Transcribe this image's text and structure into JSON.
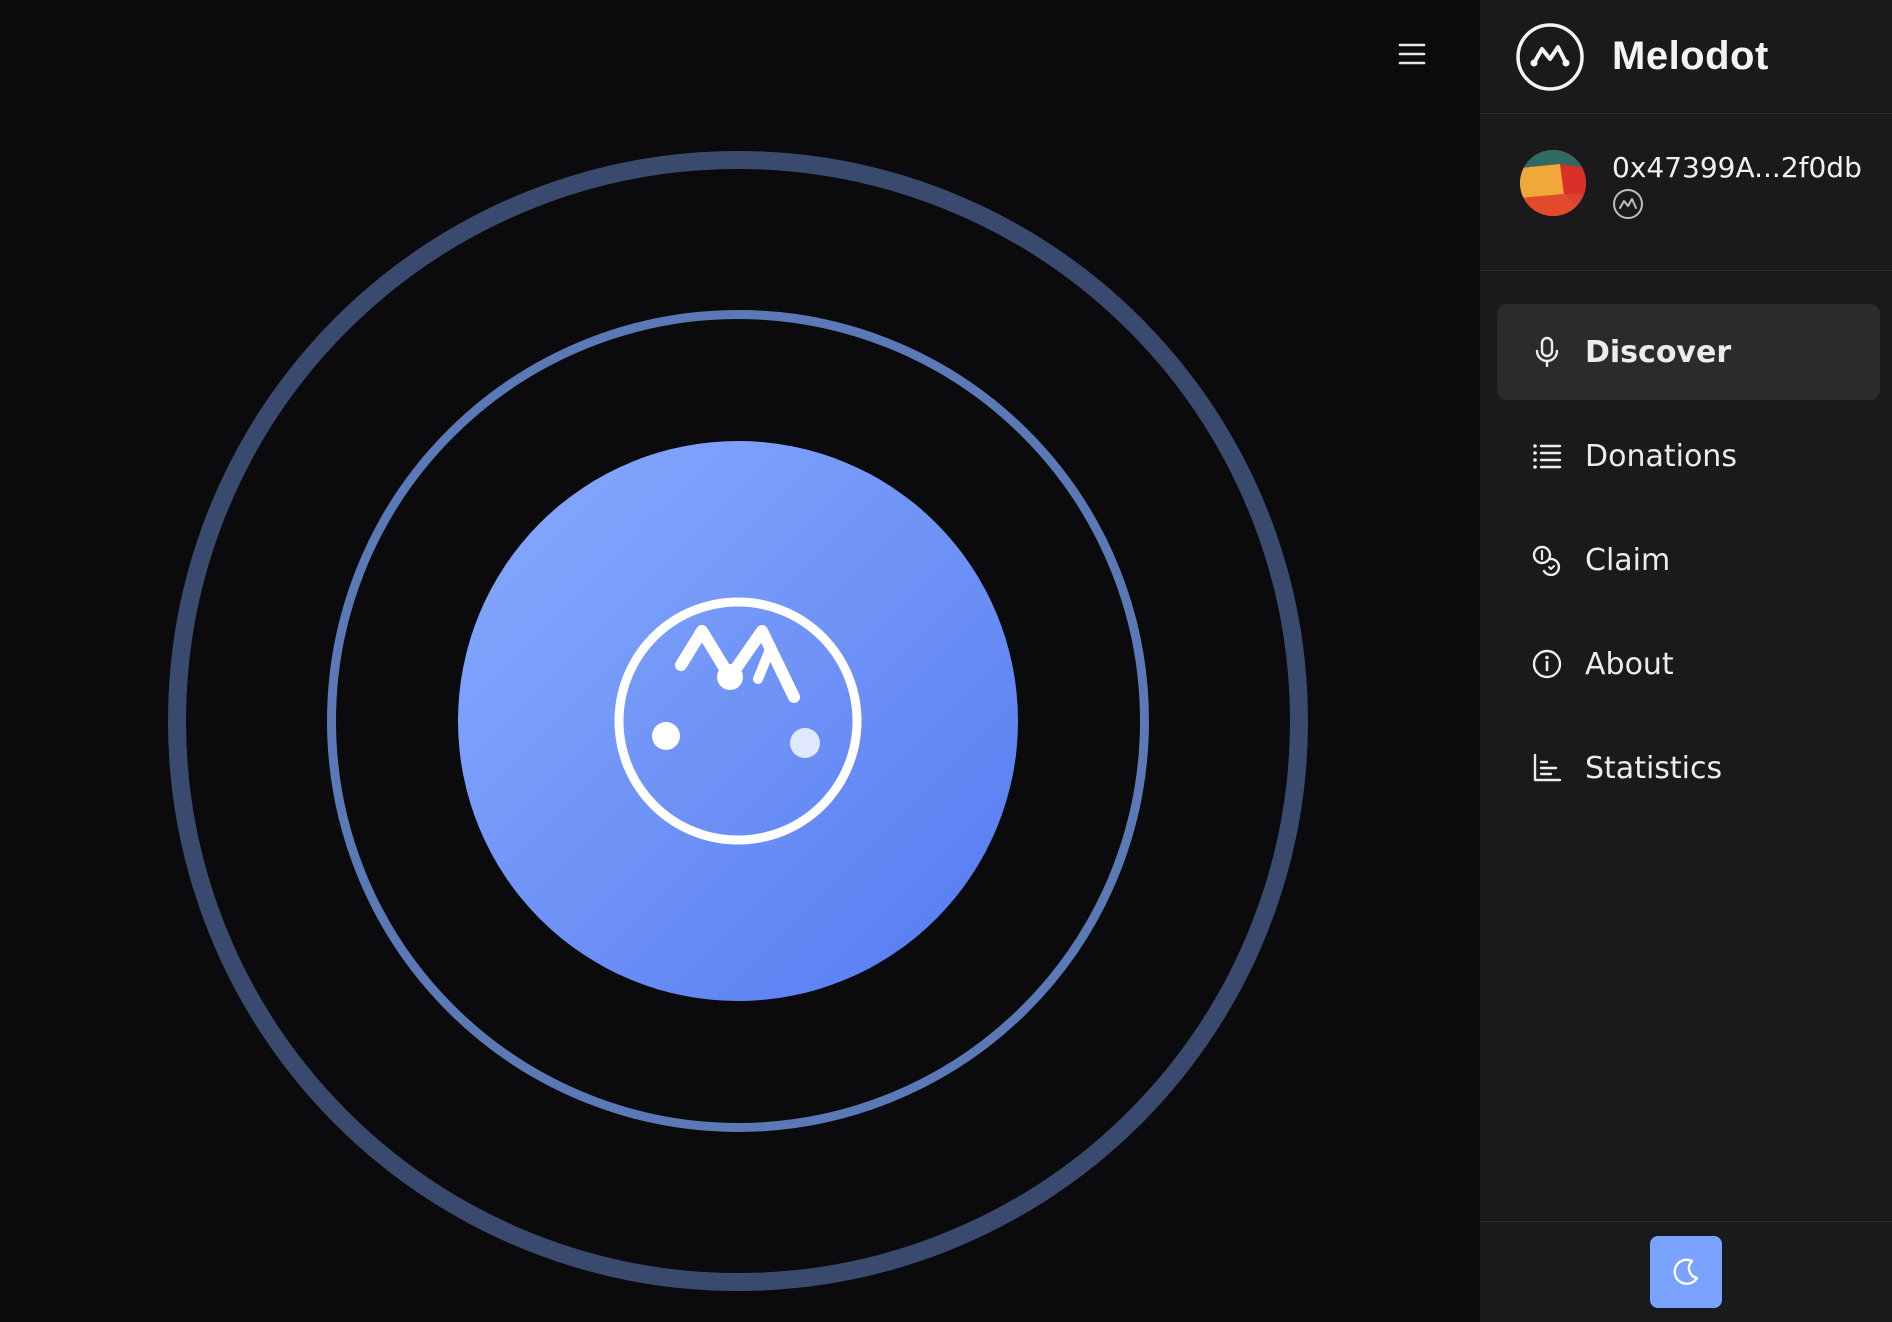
{
  "app": {
    "name": "Melodot",
    "accent_color": "#7aa3ff"
  },
  "header": {
    "menu_icon": "hamburger-menu-icon"
  },
  "record": {
    "icon": "melodot-logo-icon",
    "gradient_colors": [
      "#88acff",
      "#5479f2"
    ]
  },
  "account": {
    "address": "0x47399A...2f0db",
    "avatar": "identicon-avatar",
    "network_icon": "melodot-network-icon"
  },
  "nav": {
    "items": [
      {
        "label": "Discover",
        "icon": "microphone-icon",
        "active": true
      },
      {
        "label": "Donations",
        "icon": "list-icon",
        "active": false
      },
      {
        "label": "Claim",
        "icon": "coins-icon",
        "active": false
      },
      {
        "label": "About",
        "icon": "info-icon",
        "active": false
      },
      {
        "label": "Statistics",
        "icon": "bar-chart-icon",
        "active": false
      }
    ]
  },
  "footer": {
    "theme_toggle_icon": "moon-icon"
  }
}
